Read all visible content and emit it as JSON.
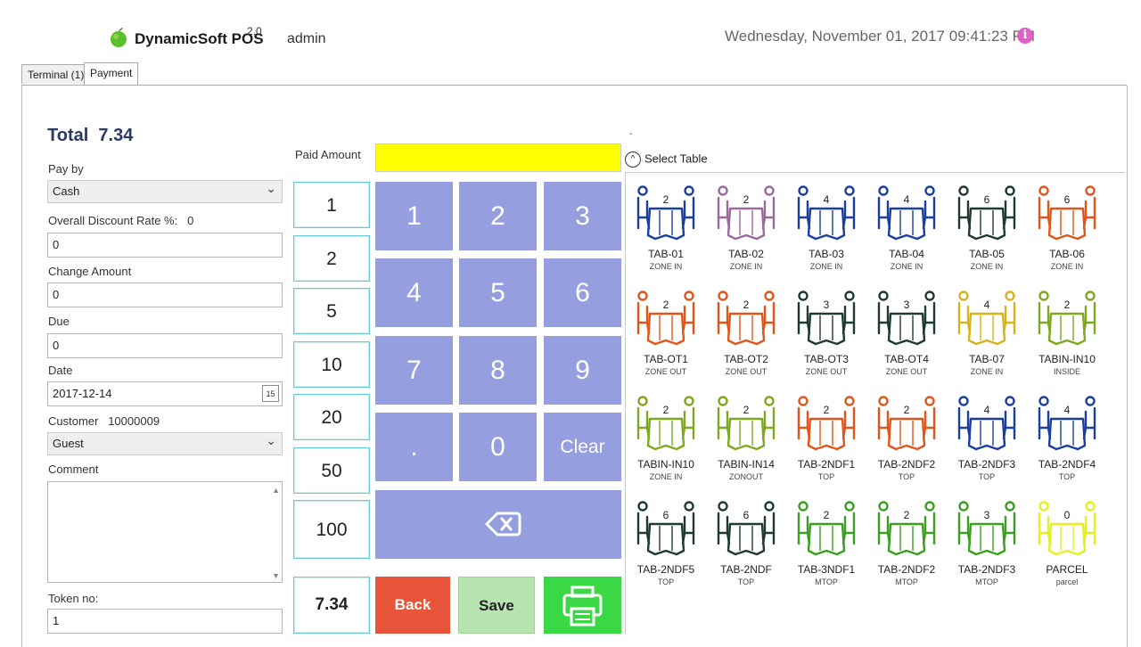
{
  "header": {
    "app_name": "DynamicSoft POS",
    "app_version": "2.0",
    "user": "admin",
    "datetime": "Wednesday,  November 01,  2017  09:41:23  PM",
    "info_icon": "info-icon"
  },
  "tabs": [
    {
      "label": "Terminal (1)",
      "active": false
    },
    {
      "label": "Payment",
      "active": true
    }
  ],
  "form": {
    "total_label": "Total",
    "total_value": "7.34",
    "pay_by_label": "Pay by",
    "pay_by_value": "Cash",
    "discount_label": "Overall Discount Rate %:",
    "discount_rate": "0",
    "discount_value": "0",
    "change_label": "Change Amount",
    "change_value": "0",
    "due_label": "Due",
    "due_value": "0",
    "date_label": "Date",
    "date_value": "2017-12-14",
    "calendar_icon_text": "15",
    "customer_label": "Customer",
    "customer_id": "10000009",
    "customer_value": "Guest",
    "comment_label": "Comment",
    "token_label": "Token no:",
    "token_value": "1"
  },
  "paid_amount_label": "Paid Amount",
  "paid_amount_value": "",
  "quick_amounts": [
    "1",
    "2",
    "5",
    "10",
    "20",
    "50",
    "100"
  ],
  "total_key": "7.34",
  "keypad": [
    "1",
    "2",
    "3",
    "4",
    "5",
    "6",
    "7",
    "8",
    "9",
    ".",
    "0",
    "Clear"
  ],
  "buttons": {
    "back": "Back",
    "save": "Save"
  },
  "select_table_label": "Select Table",
  "tables": [
    {
      "name": "TAB-01",
      "zone": "ZONE IN",
      "seats": "2",
      "color": "#1a3fa0"
    },
    {
      "name": "TAB-02",
      "zone": "ZONE IN",
      "seats": "2",
      "color": "#9a6a9a"
    },
    {
      "name": "TAB-03",
      "zone": "ZONE IN",
      "seats": "4",
      "color": "#1a3fa0"
    },
    {
      "name": "TAB-04",
      "zone": "ZONE IN",
      "seats": "4",
      "color": "#1a3fa0"
    },
    {
      "name": "TAB-05",
      "zone": "ZONE IN",
      "seats": "6",
      "color": "#1f3a2f"
    },
    {
      "name": "TAB-06",
      "zone": "ZONE IN",
      "seats": "6",
      "color": "#e0561a"
    },
    {
      "name": "TAB-OT1",
      "zone": "ZONE OUT",
      "seats": "2",
      "color": "#e0561a"
    },
    {
      "name": "TAB-OT2",
      "zone": "ZONE OUT",
      "seats": "2",
      "color": "#e0561a"
    },
    {
      "name": "TAB-OT3",
      "zone": "ZONE OUT",
      "seats": "3",
      "color": "#1f3a2f"
    },
    {
      "name": "TAB-OT4",
      "zone": "ZONE OUT",
      "seats": "3",
      "color": "#1f3a2f"
    },
    {
      "name": "TAB-07",
      "zone": "ZONE IN",
      "seats": "4",
      "color": "#d8b41c"
    },
    {
      "name": "TABIN-IN10",
      "zone": "INSIDE",
      "seats": "2",
      "color": "#7ea820"
    },
    {
      "name": "TABIN-IN10",
      "zone": "ZONE IN",
      "seats": "2",
      "color": "#7ea820"
    },
    {
      "name": "TABIN-IN14",
      "zone": "ZONOUT",
      "seats": "2",
      "color": "#7ea820"
    },
    {
      "name": "TAB-2NDF1",
      "zone": "TOP",
      "seats": "2",
      "color": "#e0561a"
    },
    {
      "name": "TAB-2NDF2",
      "zone": "TOP",
      "seats": "2",
      "color": "#e0561a"
    },
    {
      "name": "TAB-2NDF3",
      "zone": "TOP",
      "seats": "4",
      "color": "#1a3fa0"
    },
    {
      "name": "TAB-2NDF4",
      "zone": "TOP",
      "seats": "4",
      "color": "#1a3fa0"
    },
    {
      "name": "TAB-2NDF5",
      "zone": "TOP",
      "seats": "6",
      "color": "#1f3a2f"
    },
    {
      "name": "TAB-2NDF",
      "zone": "TOP",
      "seats": "6",
      "color": "#1f3a2f"
    },
    {
      "name": "TAB-3NDF1",
      "zone": "MTOP",
      "seats": "2",
      "color": "#3aa020"
    },
    {
      "name": "TAB-2NDF2",
      "zone": "MTOP",
      "seats": "2",
      "color": "#3aa020"
    },
    {
      "name": "TAB-2NDF3",
      "zone": "MTOP",
      "seats": "3",
      "color": "#3aa020"
    },
    {
      "name": "PARCEL",
      "zone": "parcel",
      "seats": "0",
      "color": "#e4f020"
    }
  ]
}
